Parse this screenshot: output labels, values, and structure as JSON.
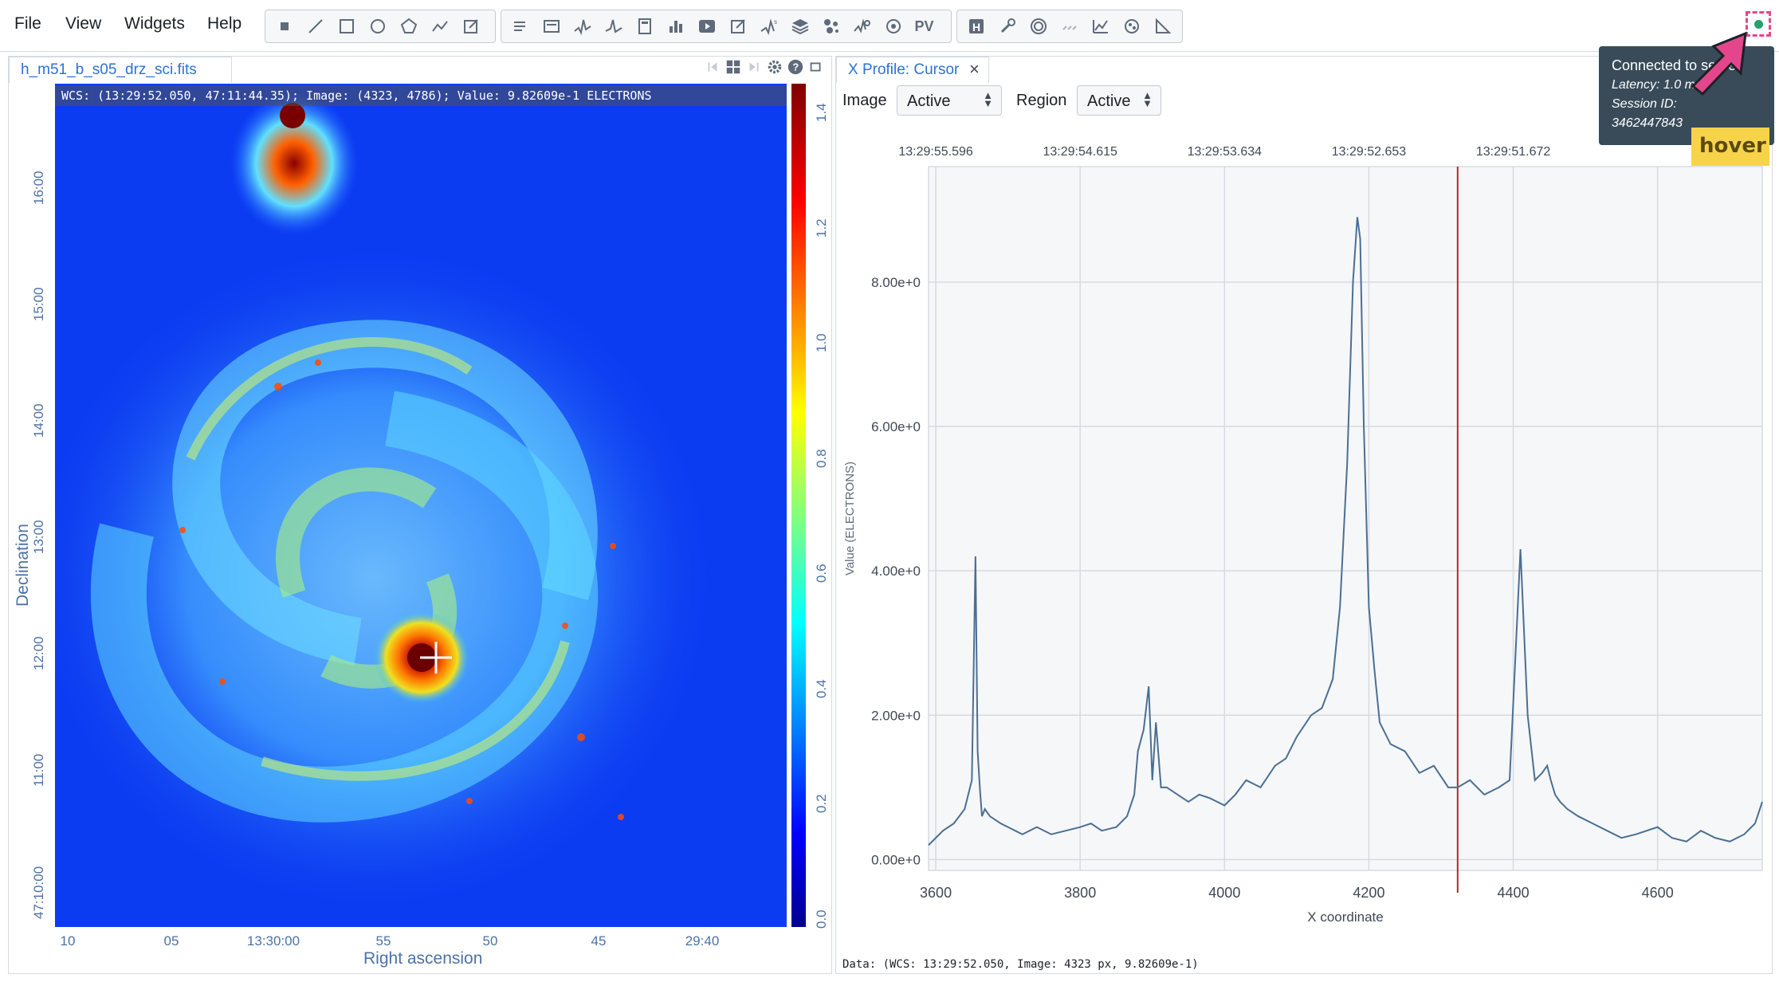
{
  "menu": [
    "File",
    "View",
    "Widgets",
    "Help"
  ],
  "toolbar": {
    "region_tools": [
      "point-region",
      "line-region",
      "rectangle-region",
      "ellipse-region",
      "polygon-region",
      "polyline-region",
      "annotation-region"
    ],
    "widget_tools": [
      "header-widget",
      "file-info-widget",
      "spatial-profiler",
      "spectral-profiler",
      "statistics-widget",
      "histogram-widget",
      "animator-widget",
      "region-list-widget",
      "stokes-analysis",
      "image-list-widget",
      "catalog-widget",
      "spectral-line-query",
      "moment-generator",
      "pv-generator"
    ],
    "pv_label": "PV",
    "dialog_tools": [
      "hdu-header",
      "preferences",
      "contour-settings",
      "vector-overlay",
      "spectral-matching",
      "fitting-tool",
      "distance-measurement"
    ]
  },
  "image_panel": {
    "tab_title": "h_m51_b_s05_drz_sci.fits",
    "wcs_info": "WCS: (13:29:52.050, 47:11:44.35); Image: (4323, 4786); Value:  9.82609e-1 ELECTRONS",
    "dec_ticks": [
      "16:00",
      "15:00",
      "14:00",
      "13:00",
      "12:00",
      "11:00",
      "47:10:00"
    ],
    "ra_ticks": [
      "10",
      "05",
      "13:30:00",
      "55",
      "50",
      "45",
      "29:40"
    ],
    "colorbar_ticks": [
      "0.0",
      "0.2",
      "0.4",
      "0.6",
      "0.8",
      "1.0",
      "1.2",
      "1.4"
    ],
    "xlabel": "Right ascension",
    "ylabel": "Declination"
  },
  "profile_panel": {
    "tab_title": "X Profile: Cursor",
    "image_label": "Image",
    "image_value": "Active",
    "region_label": "Region",
    "region_value": "Active",
    "footer": "Data: (WCS: 13:29:52.050, Image: 4323 px, 9.82609e-1)"
  },
  "chart_data": {
    "type": "line",
    "xlabel": "X coordinate",
    "ylabel": "Value (ELECTRONS)",
    "xlim": [
      3590,
      4745
    ],
    "ylim": [
      -0.15,
      9.6
    ],
    "x_ticks": [
      "3600",
      "3800",
      "4000",
      "4200",
      "4400",
      "4600"
    ],
    "y_ticks": [
      "0.00e+0",
      "2.00e+0",
      "4.00e+0",
      "6.00e+0",
      "8.00e+0"
    ],
    "top_ticks": [
      "13:29:55.596",
      "13:29:54.615",
      "13:29:53.634",
      "13:29:52.653",
      "13:29:51.672"
    ],
    "cursor_x": 4323,
    "series": [
      {
        "x": [
          3590,
          3600,
          3610,
          3625,
          3640,
          3650,
          3655,
          3658,
          3661,
          3664,
          3668,
          3675,
          3690,
          3700,
          3710,
          3720,
          3740,
          3760,
          3780,
          3800,
          3815,
          3830,
          3850,
          3865,
          3875,
          3880,
          3888,
          3895,
          3900,
          3905,
          3912,
          3920,
          3935,
          3950,
          3965,
          3980,
          4000,
          4015,
          4030,
          4050,
          4070,
          4085,
          4100,
          4120,
          4135,
          4150,
          4160,
          4170,
          4178,
          4184,
          4188,
          4193,
          4200,
          4208,
          4215,
          4230,
          4250,
          4270,
          4290,
          4310,
          4323,
          4340,
          4360,
          4380,
          4395,
          4410,
          4420,
          4430,
          4440,
          4447,
          4452,
          4458,
          4465,
          4475,
          4490,
          4510,
          4530,
          4550,
          4570,
          4600,
          4620,
          4640,
          4660,
          4680,
          4700,
          4720,
          4735,
          4745
        ],
        "y": [
          0.2,
          0.3,
          0.4,
          0.5,
          0.7,
          1.1,
          4.2,
          1.5,
          1.0,
          0.6,
          0.7,
          0.6,
          0.5,
          0.45,
          0.4,
          0.35,
          0.45,
          0.35,
          0.4,
          0.45,
          0.5,
          0.4,
          0.45,
          0.6,
          0.9,
          1.5,
          1.8,
          2.4,
          1.1,
          1.9,
          1.0,
          1.0,
          0.9,
          0.8,
          0.9,
          0.85,
          0.75,
          0.9,
          1.1,
          1.0,
          1.3,
          1.4,
          1.7,
          2.0,
          2.1,
          2.5,
          3.5,
          5.5,
          8.0,
          8.9,
          8.6,
          6.0,
          3.5,
          2.6,
          1.9,
          1.6,
          1.5,
          1.2,
          1.3,
          1.0,
          1.0,
          1.1,
          0.9,
          1.0,
          1.1,
          4.3,
          2.0,
          1.1,
          1.2,
          1.3,
          1.1,
          0.9,
          0.8,
          0.7,
          0.6,
          0.5,
          0.4,
          0.3,
          0.35,
          0.45,
          0.3,
          0.25,
          0.4,
          0.3,
          0.25,
          0.35,
          0.5,
          0.8
        ]
      }
    ]
  },
  "connection_tooltip": {
    "title": "Connected to server",
    "latency": "Latency: 1.0 ms",
    "session_label": "Session ID:",
    "session_id": "3462447843"
  },
  "hover_badge": "hover",
  "colors": {
    "accent": "#2d72d2",
    "axis": "#4c72a7",
    "profile_line": "#4a6f94",
    "cursor_line": "#b52a2a",
    "status_connected": "#23a26d"
  }
}
